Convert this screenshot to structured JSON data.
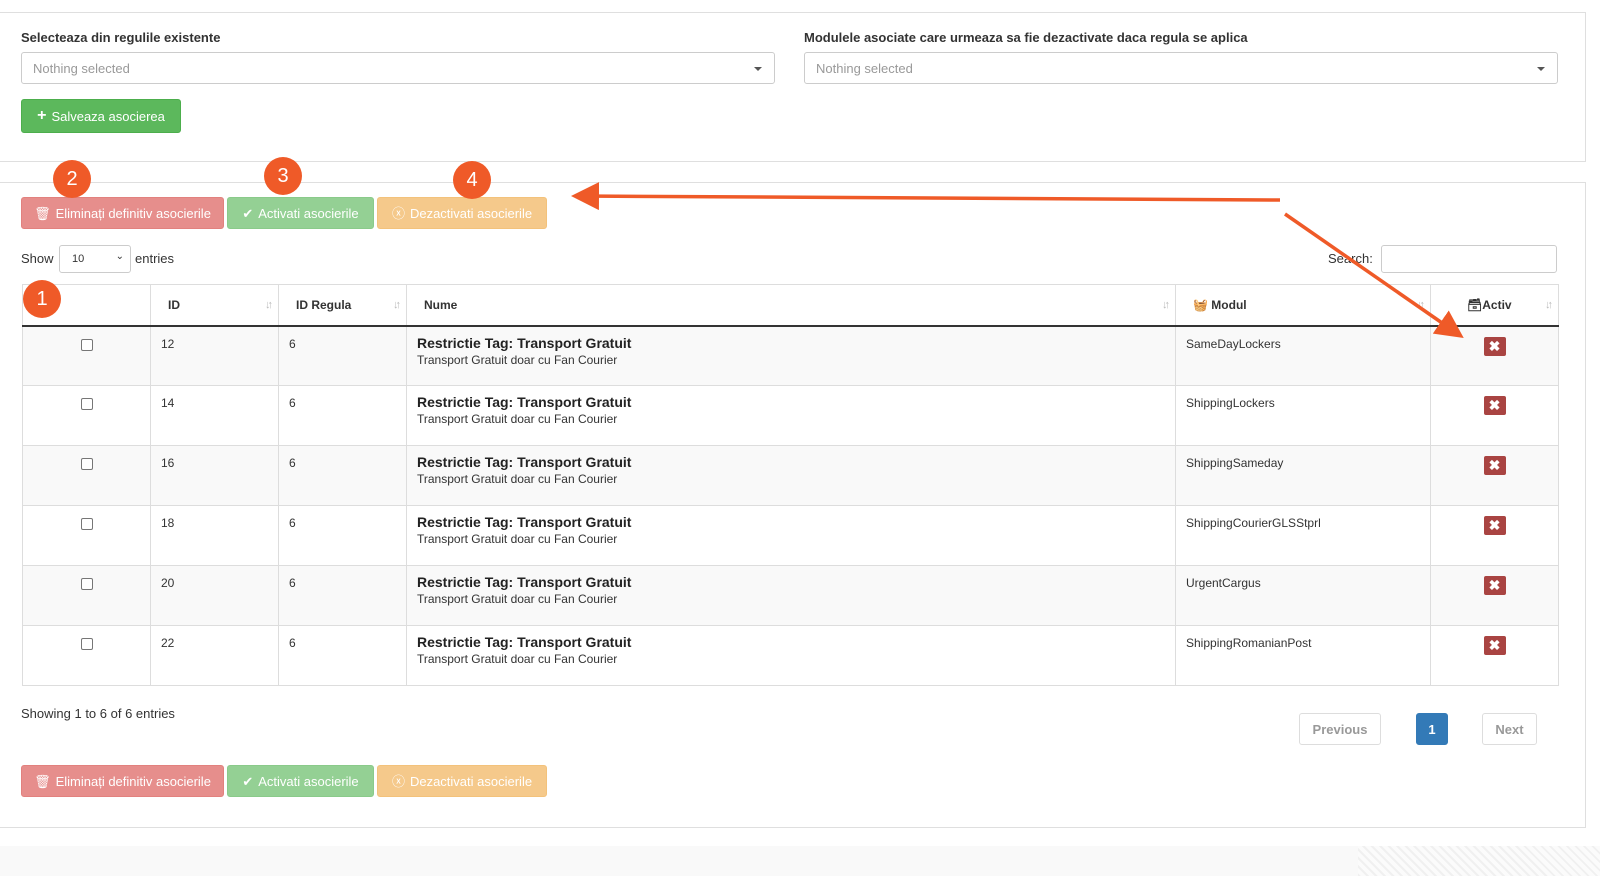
{
  "form": {
    "rule_label": "Selecteaza din regulile existente",
    "rule_placeholder": "Nothing selected",
    "modules_label": "Modulele asociate care urmeaza sa fie dezactivate daca regula se aplica",
    "modules_placeholder": "Nothing selected",
    "save_label": "Salveaza asocierea"
  },
  "actions": {
    "delete_label": "Eliminați definitiv asocierile",
    "activate_label": "Activati asocierile",
    "deactivate_label": "Dezactivati asocierile"
  },
  "annotations": [
    "1",
    "2",
    "3",
    "4"
  ],
  "table_controls": {
    "show_label": "Show",
    "length_value": "10",
    "entries_label": "entries",
    "search_label": "Search:"
  },
  "table": {
    "headers": [
      "ID",
      "ID Regula",
      "Nume",
      "Modul",
      "Activ"
    ],
    "rows": [
      {
        "id": "12",
        "rule_id": "6",
        "title": "Restrictie Tag: Transport Gratuit",
        "subtitle": "Transport Gratuit doar cu Fan Courier",
        "module": "SameDayLockers"
      },
      {
        "id": "14",
        "rule_id": "6",
        "title": "Restrictie Tag: Transport Gratuit",
        "subtitle": "Transport Gratuit doar cu Fan Courier",
        "module": "ShippingLockers"
      },
      {
        "id": "16",
        "rule_id": "6",
        "title": "Restrictie Tag: Transport Gratuit",
        "subtitle": "Transport Gratuit doar cu Fan Courier",
        "module": "ShippingSameday"
      },
      {
        "id": "18",
        "rule_id": "6",
        "title": "Restrictie Tag: Transport Gratuit",
        "subtitle": "Transport Gratuit doar cu Fan Courier",
        "module": "ShippingCourierGLSStprl"
      },
      {
        "id": "20",
        "rule_id": "6",
        "title": "Restrictie Tag: Transport Gratuit",
        "subtitle": "Transport Gratuit doar cu Fan Courier",
        "module": "UrgentCargus"
      },
      {
        "id": "22",
        "rule_id": "6",
        "title": "Restrictie Tag: Transport Gratuit",
        "subtitle": "Transport Gratuit doar cu Fan Courier",
        "module": "ShippingRomanianPost"
      }
    ],
    "activ_symbol": "✖"
  },
  "footer": {
    "info": "Showing 1 to 6 of 6 entries",
    "previous": "Previous",
    "page": "1",
    "next": "Next"
  },
  "colors": {
    "success": "#5cb85c",
    "danger": "#d9534f",
    "warning": "#f0ad4e",
    "inactive_x": "#a94442",
    "annotation": "#ef5a28",
    "page_active": "#337ab7"
  }
}
